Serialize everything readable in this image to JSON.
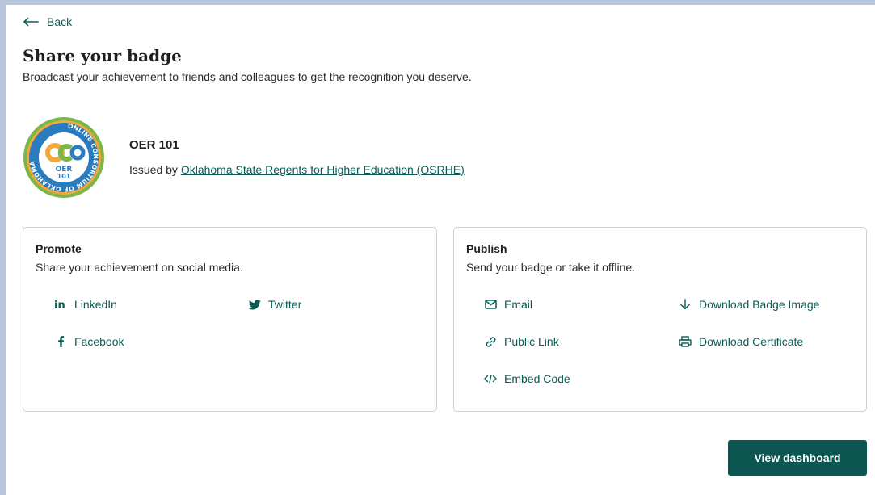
{
  "nav": {
    "back_label": "Back"
  },
  "header": {
    "title": "Share your badge",
    "subtitle": "Broadcast your achievement to friends and colleagues to get the recognition you deserve."
  },
  "badge": {
    "name": "OER 101",
    "issued_prefix": "Issued by",
    "issuer": "Oklahoma State Regents for Higher Education (OSRHE)",
    "image": {
      "ring_text": "ONLINE CONSORTIUM OF OKLAHOMA",
      "logo_text": "OCO",
      "course_line1": "OER",
      "course_line2": "101"
    }
  },
  "promote": {
    "title": "Promote",
    "description": "Share your achievement on social media.",
    "linkedin": "LinkedIn",
    "twitter": "Twitter",
    "facebook": "Facebook"
  },
  "publish": {
    "title": "Publish",
    "description": "Send your badge or take it offline.",
    "email": "Email",
    "download_image": "Download Badge Image",
    "public_link": "Public Link",
    "download_certificate": "Download Certificate",
    "embed_code": "Embed Code"
  },
  "footer": {
    "dashboard_button": "View dashboard"
  },
  "colors": {
    "accent": "#0a5c55",
    "button_bg": "#0b5650",
    "frame_bg": "#b7c6dd"
  }
}
